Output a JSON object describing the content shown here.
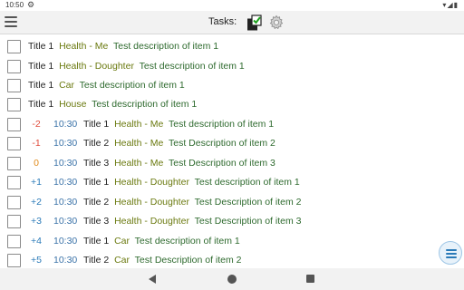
{
  "status_bar": {
    "time": "10:50"
  },
  "app_bar": {
    "tasks_label": "Tasks:"
  },
  "items": [
    {
      "diff": "",
      "time": "",
      "title": "Title 1",
      "category": "Health - Me",
      "desc": "Test description of item 1"
    },
    {
      "diff": "",
      "time": "",
      "title": "Title 1",
      "category": "Health - Doughter",
      "desc": "Test description of item 1"
    },
    {
      "diff": "",
      "time": "",
      "title": "Title 1",
      "category": "Car",
      "desc": "Test description of item 1"
    },
    {
      "diff": "",
      "time": "",
      "title": "Title 1",
      "category": "House",
      "desc": "Test description of item 1"
    },
    {
      "diff": "-2",
      "time": "10:30",
      "title": "Title 1",
      "category": "Health - Me",
      "desc": "Test description of item 1"
    },
    {
      "diff": "-1",
      "time": "10:30",
      "title": "Title 2",
      "category": "Health - Me",
      "desc": "Test Description of item 2"
    },
    {
      "diff": "0",
      "time": "10:30",
      "title": "Title 3",
      "category": "Health - Me",
      "desc": "Test Description of item 3"
    },
    {
      "diff": "+1",
      "time": "10:30",
      "title": "Title 1",
      "category": "Health - Doughter",
      "desc": "Test description of item 1"
    },
    {
      "diff": "+2",
      "time": "10:30",
      "title": "Title 2",
      "category": "Health - Doughter",
      "desc": "Test Description of item 2"
    },
    {
      "diff": "+3",
      "time": "10:30",
      "title": "Title 3",
      "category": "Health - Doughter",
      "desc": "Test Description of item 3"
    },
    {
      "diff": "+4",
      "time": "10:30",
      "title": "Title 1",
      "category": "Car",
      "desc": "Test description of item 1"
    },
    {
      "diff": "+5",
      "time": "10:30",
      "title": "Title 2",
      "category": "Car",
      "desc": "Test Description of item 2"
    }
  ],
  "icons": {
    "menu": "hamburger-menu-icon",
    "tasks": "tasks-checkbox-icon",
    "settings": "gear-icon",
    "fab": "list-menu-icon",
    "nav_back": "triangle-back-icon",
    "nav_home": "circle-home-icon",
    "nav_recents": "square-recents-icon"
  },
  "colors": {
    "time": "#3a72a8",
    "category": "#6b7a10",
    "description": "#2e6a2e",
    "negative": "#e04a3a",
    "zero": "#e08a1a",
    "positive": "#2a7ab8",
    "check_green": "#1ca11c"
  }
}
